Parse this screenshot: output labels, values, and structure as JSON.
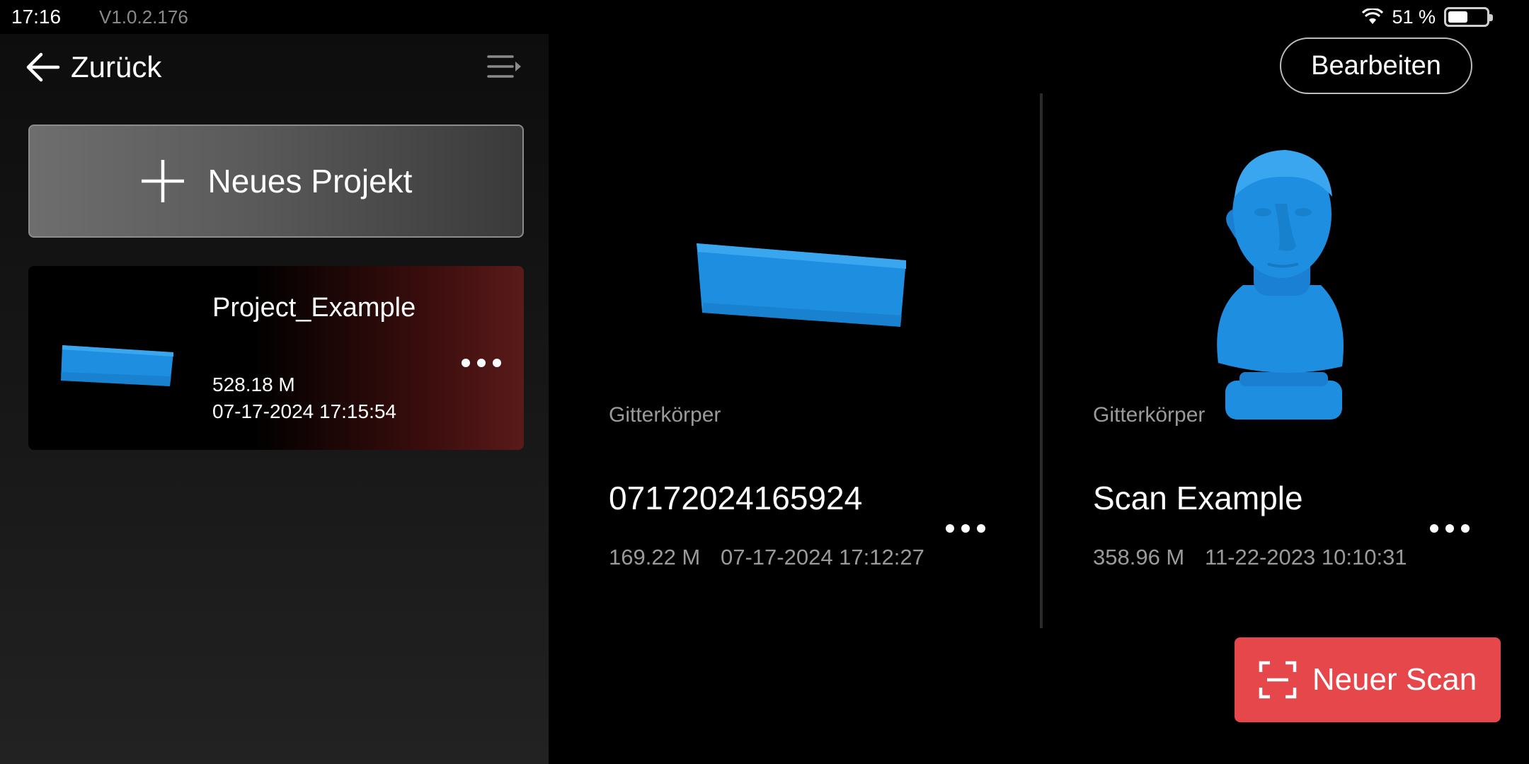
{
  "status_bar": {
    "time": "17:16",
    "version": "V1.0.2.176",
    "battery_percent": "51 %",
    "battery_level": 0.51,
    "icons": [
      "wifi-icon",
      "battery-icon"
    ]
  },
  "nav": {
    "back_label": "Zurück",
    "back_icon": "arrow-left-icon",
    "list_icon": "list-collapse-icon"
  },
  "left_panel": {
    "new_project_label": "Neues Projekt",
    "new_project_icon": "plus-icon",
    "projects": [
      {
        "name": "Project_Example",
        "size": "528.18 M",
        "date": "07-17-2024 17:15:54",
        "thumbnail": "blue-bar-scan",
        "menu_icon": "more-dots-icon"
      }
    ]
  },
  "header": {
    "edit_label": "Bearbeiten"
  },
  "scans": [
    {
      "type": "Gitterkörper",
      "title": "07172024165924",
      "size": "169.22 M",
      "date": "07-17-2024 17:12:27",
      "thumbnail": "blue-bar-scan"
    },
    {
      "type": "Gitterkörper",
      "title": "Scan Example",
      "size": "358.96 M",
      "date": "11-22-2023 10:10:31",
      "thumbnail": "blue-bust-scan"
    }
  ],
  "new_scan": {
    "label": "Neuer Scan",
    "icon": "scan-frame-icon"
  },
  "colors": {
    "accent": "#e5474b",
    "scan_blue": "#1e8fe0",
    "muted_text": "#9a9a9a"
  }
}
